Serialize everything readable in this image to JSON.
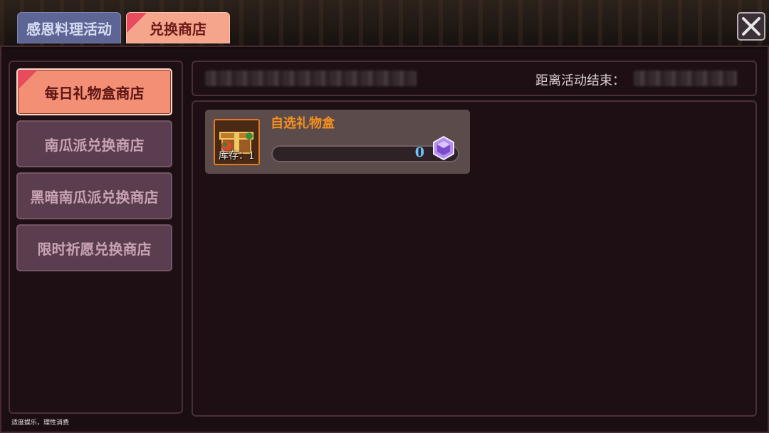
{
  "tabs": [
    {
      "label": "感恩料理活动",
      "active": false
    },
    {
      "label": "兑换商店",
      "active": true
    }
  ],
  "close_icon": "close-icon",
  "menu": [
    {
      "label": "每日礼物盒商店",
      "active": true
    },
    {
      "label": "南瓜派兑换商店",
      "active": false
    },
    {
      "label": "黑暗南瓜派兑换商店",
      "active": false
    },
    {
      "label": "限时祈愿兑换商店",
      "active": false
    }
  ],
  "header": {
    "countdown_label": "距离活动结束："
  },
  "item": {
    "name": "自选礼物盒",
    "stock_label": "库存：1",
    "price": "0",
    "currency_icon": "purple-gem-icon",
    "item_icon": "gift-box-icon"
  },
  "footer": {
    "note": "适度娱乐，理性消费"
  },
  "colors": {
    "active_tab": "#f4a58c",
    "inactive_tab": "#5d6594",
    "item_name": "#f6901e",
    "price": "#6ec6ff"
  }
}
